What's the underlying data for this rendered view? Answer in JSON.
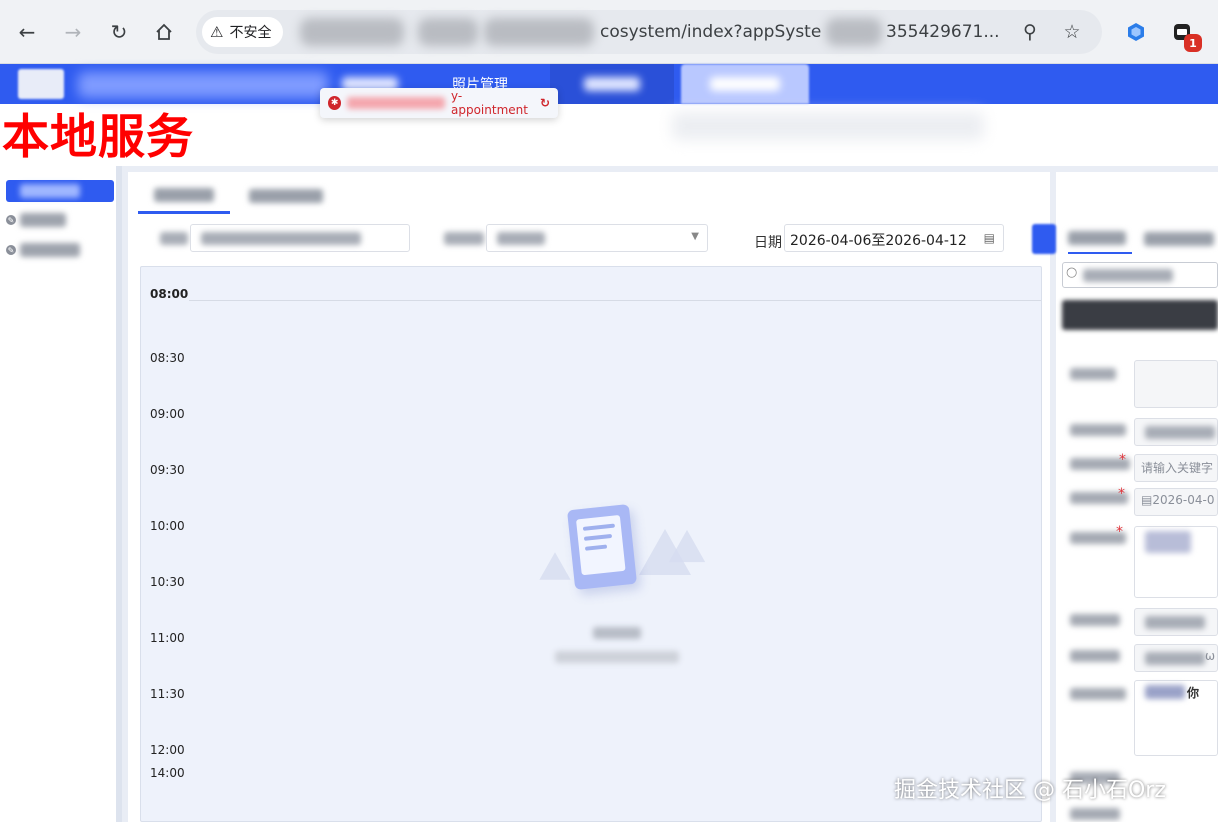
{
  "browser": {
    "security_label": "不安全",
    "url_visible": "cosystem/index?appSyste",
    "url_tail": "355429671...",
    "ext_badge": "1"
  },
  "header": {
    "nav_item_2": "照片管理",
    "tooltip_text": "y-appointment"
  },
  "page": {
    "title": "本地服务"
  },
  "filters": {
    "date_label": "日期",
    "date_range": "2026-04-06至2026-04-12"
  },
  "schedule": {
    "times": [
      "08:00",
      "08:30",
      "09:00",
      "09:30",
      "10:00",
      "10:30",
      "11:00",
      "11:30",
      "12:00",
      "14:00"
    ]
  },
  "right_panel": {
    "keyword_placeholder": "请输入关键字",
    "date_value": "2026-04-0",
    "partial_text": "你",
    "partial_text_2": "ω"
  },
  "watermark": "掘金技术社区 @ 石小石Orz",
  "colors": {
    "brand_blue": "#2f5bf0",
    "title_red": "#ff0000",
    "required_red": "#e0333a"
  }
}
